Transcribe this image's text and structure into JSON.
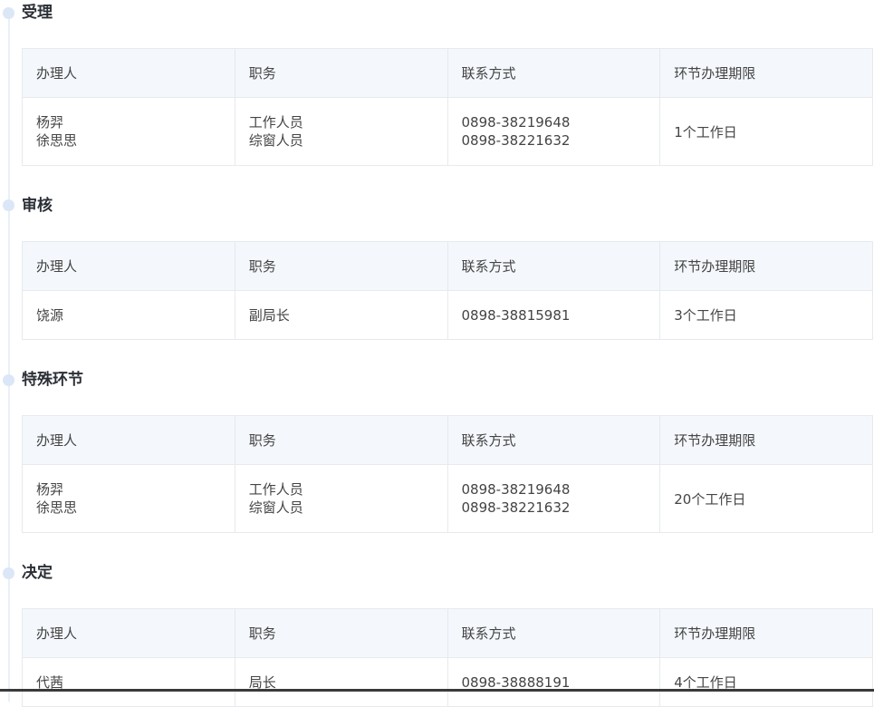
{
  "headers": {
    "handler": "办理人",
    "position": "职务",
    "contact": "联系方式",
    "deadline": "环节办理期限"
  },
  "stages": [
    {
      "title": "受理",
      "handlers": [
        "杨羿",
        "徐思思"
      ],
      "positions": [
        "工作人员",
        "综窗人员"
      ],
      "contacts": [
        "0898-38219648",
        "0898-38221632"
      ],
      "deadline": "1个工作日"
    },
    {
      "title": "审核",
      "handlers": [
        "饶源"
      ],
      "positions": [
        "副局长"
      ],
      "contacts": [
        "0898-38815981"
      ],
      "deadline": "3个工作日"
    },
    {
      "title": "特殊环节",
      "handlers": [
        "杨羿",
        "徐思思"
      ],
      "positions": [
        "工作人员",
        "综窗人员"
      ],
      "contacts": [
        "0898-38219648",
        "0898-38221632"
      ],
      "deadline": "20个工作日"
    },
    {
      "title": "决定",
      "handlers": [
        "代茜"
      ],
      "positions": [
        "局长"
      ],
      "contacts": [
        "0898-38888191"
      ],
      "deadline": "4个工作日"
    }
  ],
  "colors": {
    "header_bg": "#f4f8fc",
    "border": "#e6eaef",
    "timeline_dot": "#dbe7f6",
    "title_text": "#2b2f36"
  }
}
